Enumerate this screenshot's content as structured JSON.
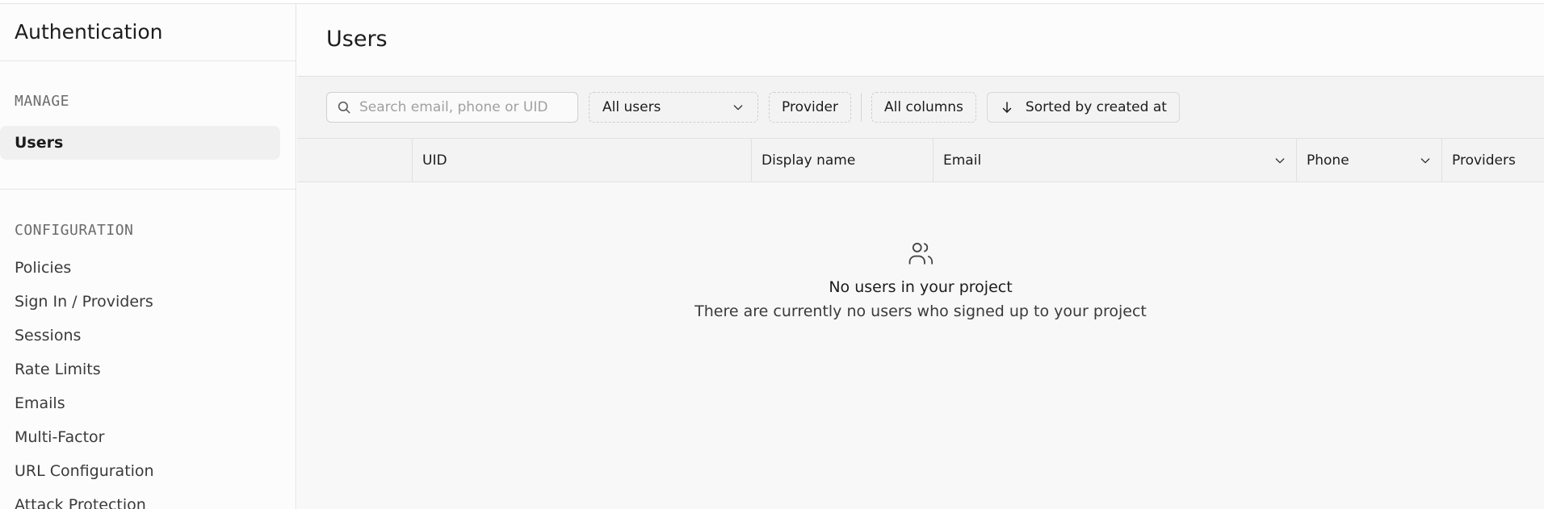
{
  "sidebar": {
    "title": "Authentication",
    "manage_label": "MANAGE",
    "active_item": "Users",
    "configuration_label": "CONFIGURATION",
    "config_items": [
      "Policies",
      "Sign In / Providers",
      "Sessions",
      "Rate Limits",
      "Emails",
      "Multi-Factor",
      "URL Configuration",
      "Attack Protection"
    ]
  },
  "main": {
    "title": "Users",
    "search_placeholder": "Search email, phone or UID",
    "filter_selected": "All users",
    "provider_label": "Provider",
    "columns_label": "All columns",
    "sort_label": "Sorted by created at",
    "table_columns": [
      "UID",
      "Display name",
      "Email",
      "Phone",
      "Providers"
    ],
    "empty_title": "No users in your project",
    "empty_subtitle": "There are currently no users who signed up to your project"
  },
  "icons": {
    "search": "search-icon",
    "chevron": "chevron-down-icon",
    "sort": "arrow-down-icon",
    "users": "users-icon"
  },
  "colors": {
    "background": "#f8f8f8",
    "sidebar": "#fcfcfc",
    "active_item": "#f0f0f0",
    "border": "#e2e2e2"
  }
}
